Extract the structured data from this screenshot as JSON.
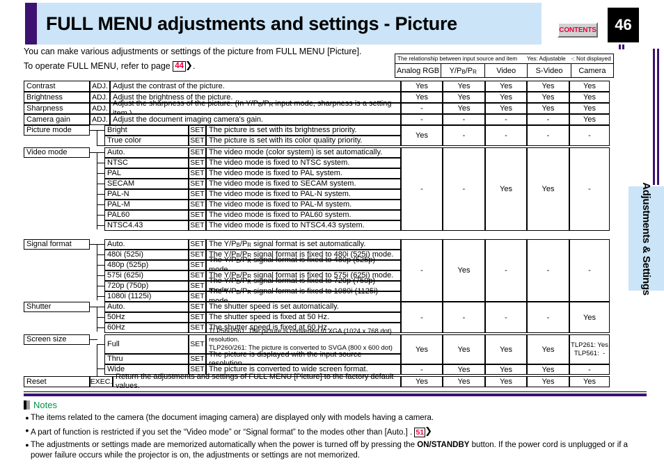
{
  "header": {
    "title": "FULL MENU adjustments and settings - Picture",
    "contents_label": "CONTENTS",
    "page_number": "46"
  },
  "intro": {
    "line1": "You can make various adjustments or settings of the picture from FULL MENU [Picture].",
    "line2_a": "To operate FULL MENU, refer to page",
    "line2_link": "44",
    "line2_b": "."
  },
  "legend": {
    "caption": "The relationship between input source and item",
    "yes_note": "Yes: Adjustable",
    "dash_note": "-: Not displayed",
    "columns": [
      "Analog RGB",
      "Y/PB/PR",
      "Video",
      "S-Video",
      "Camera"
    ]
  },
  "table": {
    "rows": [
      {
        "name": "Contrast",
        "action": "ADJ.",
        "desc": "Adjust the contrast of the picture.",
        "values": [
          "Yes",
          "Yes",
          "Yes",
          "Yes",
          "Yes"
        ]
      },
      {
        "name": "Brightness",
        "action": "ADJ.",
        "desc": "Adjust the brightness of the picture.",
        "values": [
          "Yes",
          "Yes",
          "Yes",
          "Yes",
          "Yes"
        ]
      },
      {
        "name": "Sharpness",
        "action": "ADJ.",
        "desc": "Adjust the sharpness of the picture. (In Y/PB/PR input mode, sharpness is a setting item.)",
        "values": [
          "-",
          "Yes",
          "Yes",
          "Yes",
          "Yes"
        ]
      },
      {
        "name": "Camera gain",
        "action": "ADJ.",
        "desc": "Adjust the document imaging camera's gain.",
        "values": [
          "-",
          "-",
          "-",
          "-",
          "Yes"
        ]
      }
    ],
    "groups": [
      {
        "name": "Picture mode",
        "values": [
          "Yes",
          "-",
          "-",
          "-",
          "-"
        ],
        "items": [
          {
            "label": "Bright",
            "action": "SET",
            "desc": "The picture is set with its brightness priority."
          },
          {
            "label": "True color",
            "action": "SET",
            "desc": "The picture is set with its color quality priority."
          }
        ]
      },
      {
        "name": "Video mode",
        "values": [
          "-",
          "-",
          "Yes",
          "Yes",
          "-"
        ],
        "items": [
          {
            "label": "Auto.",
            "action": "SET",
            "desc": "The video mode (color system) is set automatically."
          },
          {
            "label": "NTSC",
            "action": "SET",
            "desc": "The video mode is fixed to NTSC system."
          },
          {
            "label": "PAL",
            "action": "SET",
            "desc": "The video mode is fixed to PAL system."
          },
          {
            "label": "SECAM",
            "action": "SET",
            "desc": "The video mode is fixed to SECAM system."
          },
          {
            "label": "PAL-N",
            "action": "SET",
            "desc": "The video mode is fixed to PAL-N system."
          },
          {
            "label": "PAL-M",
            "action": "SET",
            "desc": "The video mode is fixed to PAL-M system."
          },
          {
            "label": "PAL60",
            "action": "SET",
            "desc": "The video mode is fixed to PAL60 system."
          },
          {
            "label": "NTSC4.43",
            "action": "SET",
            "desc": "The video mode is fixed to NTSC4.43 system."
          }
        ]
      },
      {
        "name": "Signal format",
        "values": [
          "-",
          "Yes",
          "-",
          "-",
          "-"
        ],
        "items": [
          {
            "label": "Auto.",
            "action": "SET",
            "desc": "The Y/PB/PR signal format is set automatically."
          },
          {
            "label": "480i (525i)",
            "action": "SET",
            "desc": "The Y/PB/PR signal format is fixed to 480i (525i) mode."
          },
          {
            "label": "480p (525p)",
            "action": "SET",
            "desc": "The Y/PB/PR signal format is fixed to 480p (525p) mode."
          },
          {
            "label": "575i (625i)",
            "action": "SET",
            "desc": "The Y/PB/PR signal format is fixed to 575i (625i) mode."
          },
          {
            "label": "720p (750p)",
            "action": "SET",
            "desc": "The Y/PB/PR signal format is fixed to 720p (750p) mode."
          },
          {
            "label": "1080i (1125i)",
            "action": "SET",
            "desc": "The Y/PB/PR signal format is fixed to 1080i (1125i) mode."
          }
        ]
      },
      {
        "name": "Shutter",
        "values": [
          "-",
          "-",
          "-",
          "-",
          "Yes"
        ],
        "items": [
          {
            "label": "Auto.",
            "action": "SET",
            "desc": "The shutter speed is set automatically."
          },
          {
            "label": "50Hz",
            "action": "SET",
            "desc": "The shutter speed is fixed at 50 Hz."
          },
          {
            "label": "60Hz",
            "action": "SET",
            "desc": "The shutter speed is fixed at 60 Hz."
          }
        ]
      }
    ],
    "screen_size": {
      "name": "Screen size",
      "full": {
        "label": "Full",
        "action": "SET",
        "desc_line1": "TLP560/561: The picture is converted to XGA (1024 x 768 dot) resolution.",
        "desc_line2": "TLP260/261: The picture is converted to SVGA (800 x 600 dot) resolution."
      },
      "thru": {
        "label": "Thru",
        "action": "SET",
        "desc": "The picture is displayed with the input source resolution."
      },
      "wide": {
        "label": "Wide",
        "action": "SET",
        "desc": "The picture is converted to wide screen format."
      },
      "values_full_thru": [
        "Yes",
        "Yes",
        "Yes",
        "Yes",
        "TLP261: Yes|TLP561:  -"
      ],
      "values_wide": [
        "-",
        "Yes",
        "Yes",
        "Yes",
        "-"
      ]
    },
    "reset": {
      "name": "Reset",
      "action": "EXEC.",
      "desc": "Return the adjustments and settings of FULL MENU [Picture] to the factory default values.",
      "values": [
        "Yes",
        "Yes",
        "Yes",
        "Yes",
        "Yes"
      ]
    }
  },
  "notes": {
    "title": "Notes",
    "items": [
      "The items related to the camera (the document imaging camera) are displayed only with models having a camera.",
      "A part of function is restricted if you set the “Video mode” or “Signal format” to the modes other than [Auto.] .",
      "The adjustments or settings made are memorized automatically when the power is turned off by pressing the ON/STANDBY button. If the power cord is unplugged or if a power failure occurs while the projector is on, the adjustments or settings are not memorized."
    ],
    "link2": "51",
    "note3_pre": "The adjustments or settings made are memorized automatically when the power is turned off by pressing the ",
    "note3_bold": "ON/STANDBY",
    "note3_post": " button. If the power cord is unplugged or if a power failure occurs while the projector is on, the adjustments or settings are not memorized."
  },
  "side_tab": {
    "label": "Adjustments & Settings"
  },
  "colors": {
    "banner": "#cbe4f7",
    "purple": "#3d1270",
    "red": "#e8003c",
    "green": "#009147"
  }
}
